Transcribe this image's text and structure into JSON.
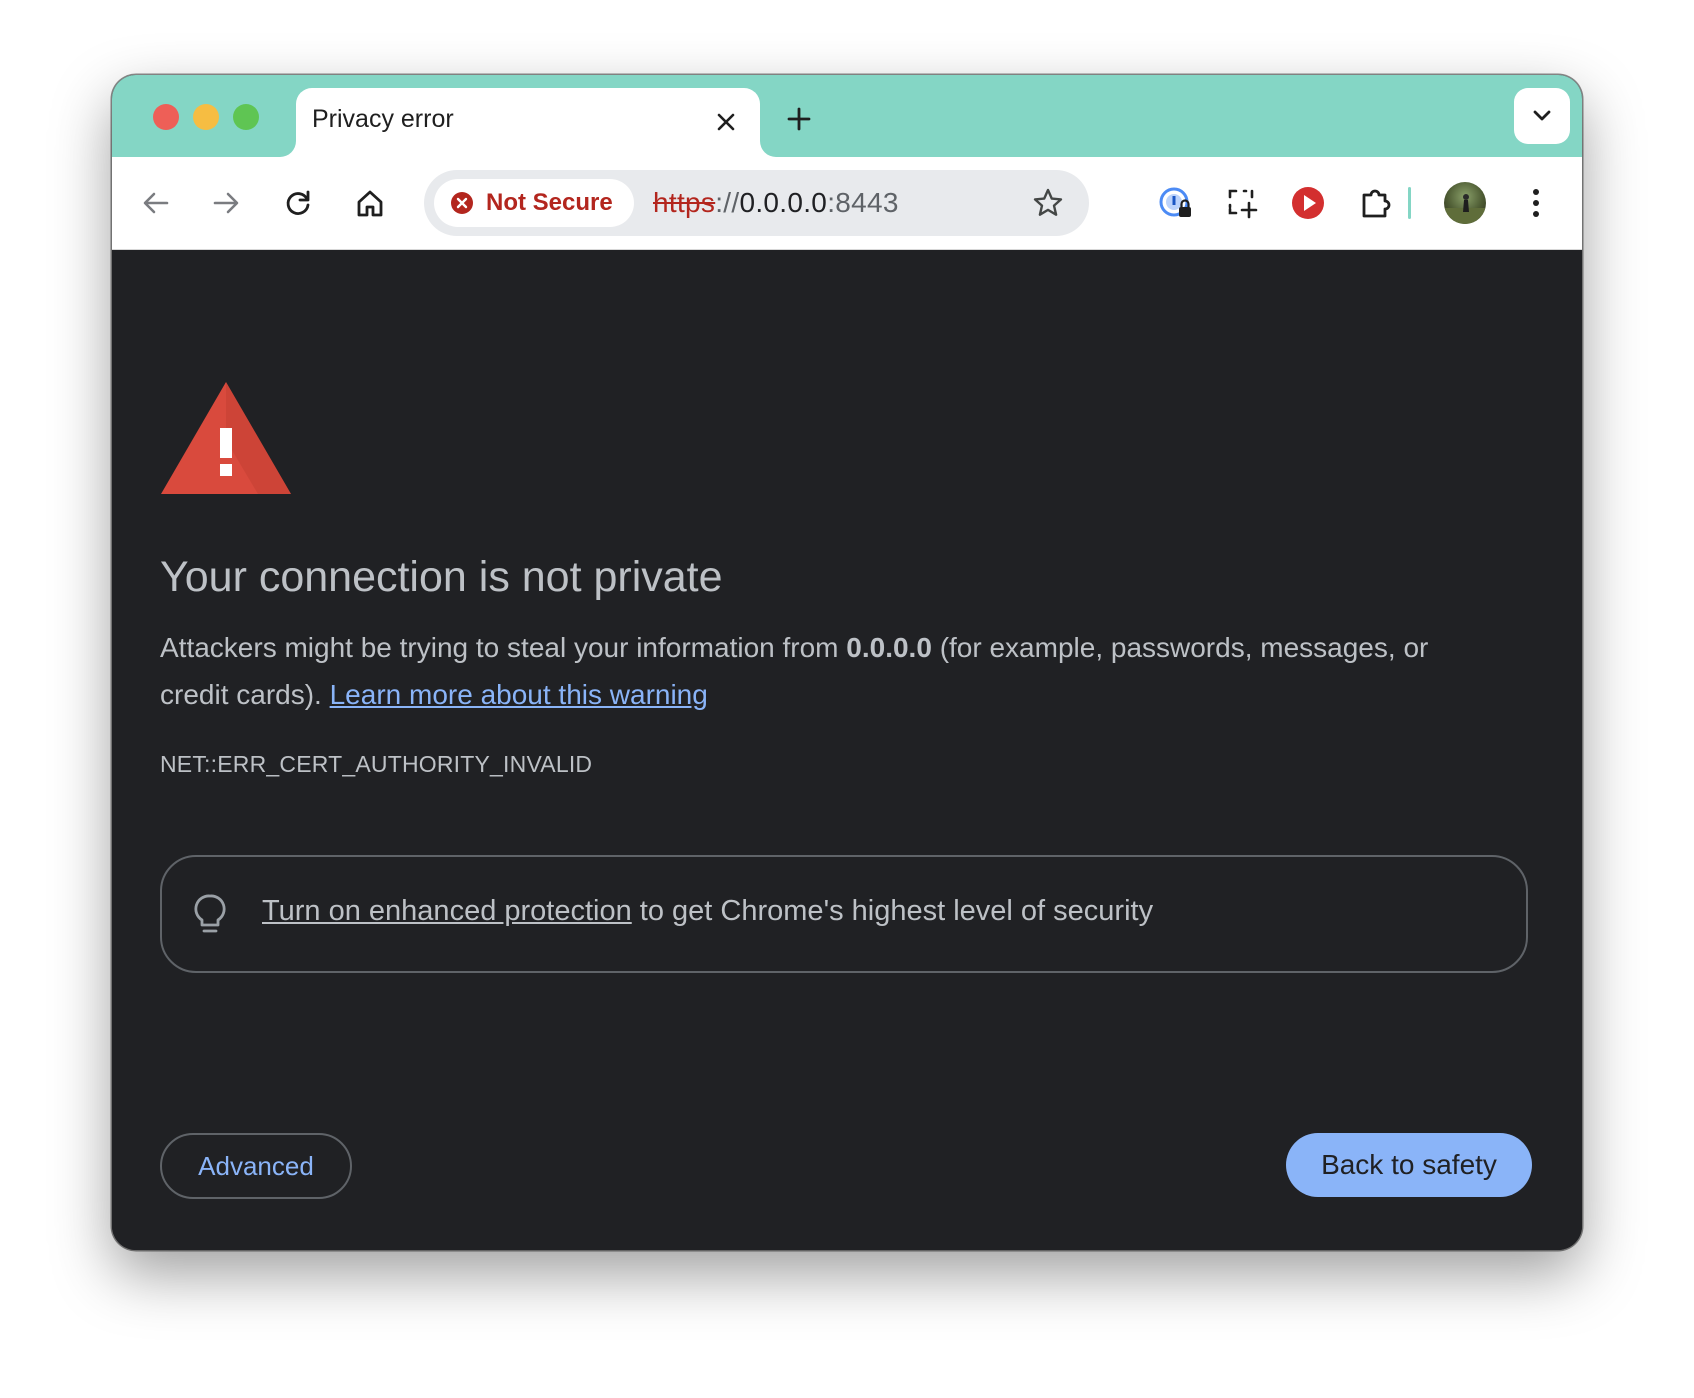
{
  "tab": {
    "title": "Privacy error"
  },
  "toolbar": {
    "security_label": "Not Secure",
    "url": {
      "scheme": "https",
      "separator": "://",
      "host": "0.0.0.0",
      "port": ":8443"
    }
  },
  "icons": {
    "back": "arrow-back-icon",
    "forward": "arrow-forward-icon",
    "reload": "reload-icon",
    "home": "home-icon",
    "bookmark": "star-icon",
    "password_manager": "password-lock-icon",
    "screenshot": "screenshot-crop-icon",
    "media": "play-circle-icon",
    "extensions": "puzzle-piece-icon",
    "menu": "three-dots-menu-icon",
    "warning": "warning-triangle-icon",
    "bulb": "lightbulb-icon"
  },
  "page": {
    "heading": "Your connection is not private",
    "description_prefix": "Attackers might be trying to steal your information from ",
    "description_host": "0.0.0.0",
    "description_suffix": " (for example, passwords, messages, or credit cards). ",
    "learn_more": "Learn more about this warning",
    "error_code": "NET::ERR_CERT_AUTHORITY_INVALID",
    "enhanced_link": "Turn on enhanced protection",
    "enhanced_rest": " to get Chrome's highest level of security",
    "advanced_button": "Advanced",
    "back_button": "Back to safety"
  },
  "colors": {
    "tabstrip": "#84d6c5",
    "page_background": "#202124",
    "text": "#bdc1c6",
    "link": "#8ab4f8",
    "danger": "#b3261e",
    "warning_red": "#d94a3d"
  }
}
